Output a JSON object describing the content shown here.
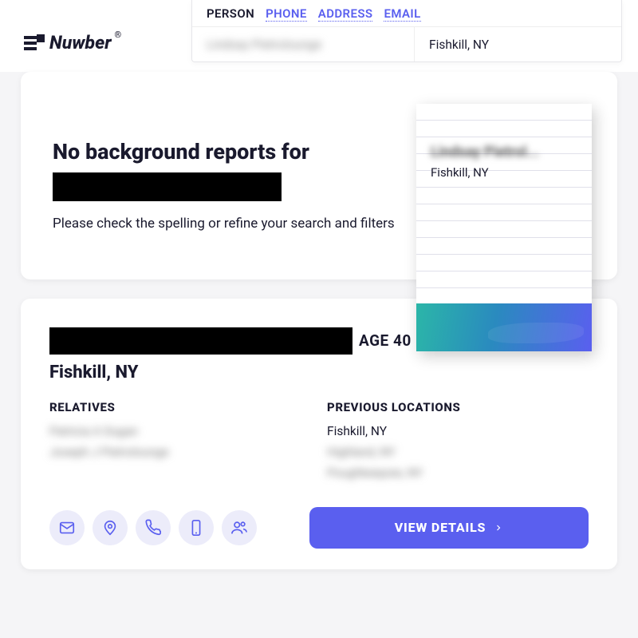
{
  "brand": {
    "name": "Nuwber",
    "reg": "®"
  },
  "search": {
    "tabs": {
      "person": "PERSON",
      "phone": "PHONE",
      "address": "ADDRESS",
      "email": "EMAIL"
    },
    "name_blur": "Lindsay Pietrolounge",
    "location": "Fishkill, NY"
  },
  "noreports": {
    "title": "No background reports for",
    "subtitle": "Please check the spelling or refine your search and filters"
  },
  "folder": {
    "name_blur": "Lindsay Pietrol...",
    "location": "Fishkill, NY"
  },
  "result": {
    "age_label": "AGE 40",
    "location": "Fishkill, NY",
    "relatives_label": "RELATIVES",
    "relatives_blur": [
      "Patricia A Dugan",
      "Joseph J Pietrolounge"
    ],
    "prevloc_label": "PREVIOUS LOCATIONS",
    "prevloc_items": [
      "Fishkill, NY"
    ],
    "prevloc_blur": [
      "Highland, NY",
      "Poughkeepsie, NY"
    ],
    "view_label": "VIEW DETAILS"
  }
}
